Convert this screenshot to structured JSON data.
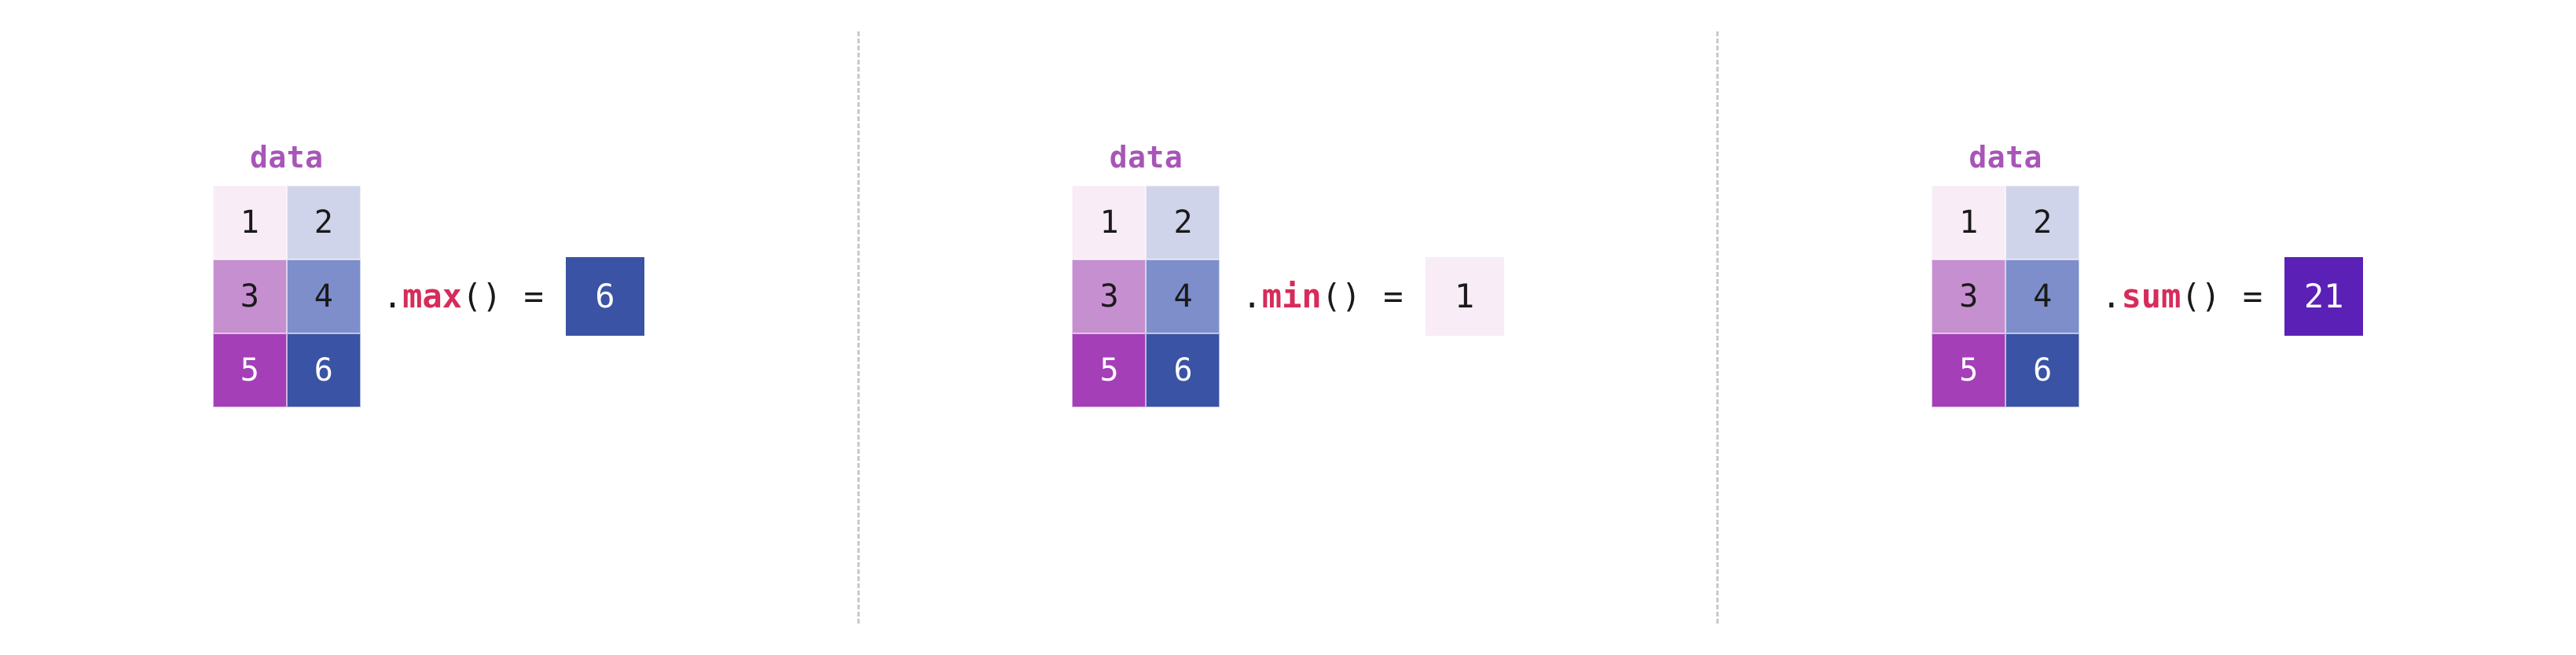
{
  "panels": [
    {
      "label": "data",
      "cells": [
        "1",
        "2",
        "3",
        "4",
        "5",
        "6"
      ],
      "op_dot": ".",
      "op_fn": "max",
      "op_paren": "()",
      "eq": "=",
      "result": "6"
    },
    {
      "label": "data",
      "cells": [
        "1",
        "2",
        "3",
        "4",
        "5",
        "6"
      ],
      "op_dot": ".",
      "op_fn": "min",
      "op_paren": "()",
      "eq": "=",
      "result": "1"
    },
    {
      "label": "data",
      "cells": [
        "1",
        "2",
        "3",
        "4",
        "5",
        "6"
      ],
      "op_dot": ".",
      "op_fn": "sum",
      "op_paren": "()",
      "eq": "=",
      "result": "21"
    }
  ]
}
